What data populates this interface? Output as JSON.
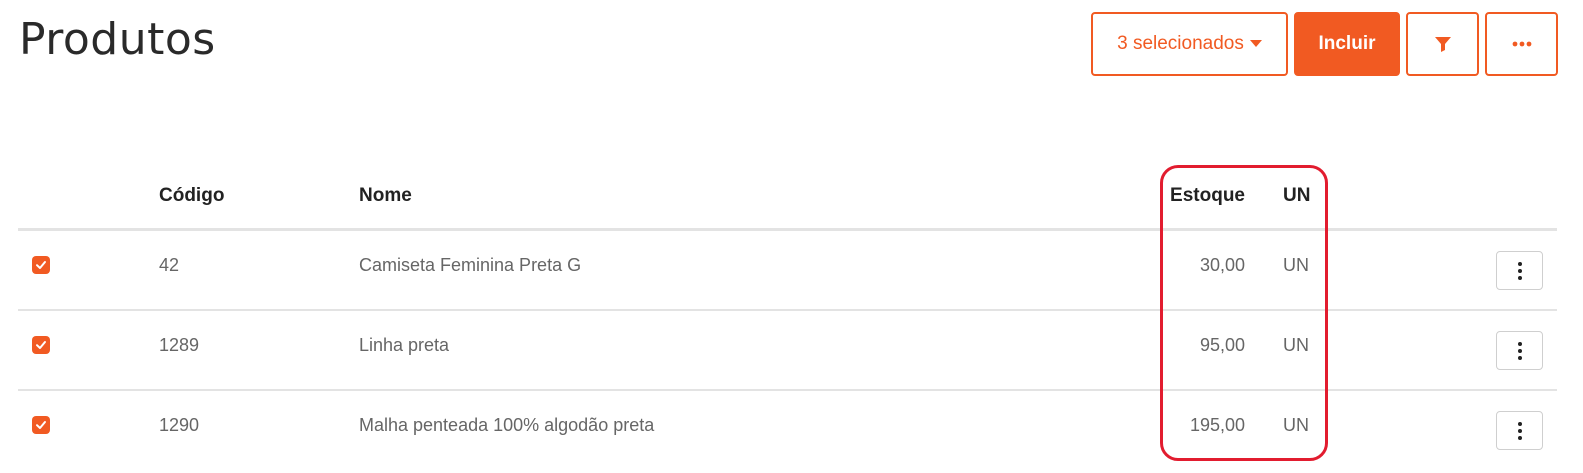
{
  "page": {
    "title": "Produtos"
  },
  "toolbar": {
    "selection_label": "3 selecionados",
    "include_label": "Incluir",
    "filter_icon": "filter-icon",
    "more_icon": "ellipsis-icon"
  },
  "table": {
    "headers": {
      "code": "Código",
      "name": "Nome",
      "stock": "Estoque",
      "unit": "UN"
    },
    "rows": [
      {
        "checked": true,
        "code": "42",
        "name": "Camiseta Feminina Preta G",
        "stock": "30,00",
        "unit": "UN"
      },
      {
        "checked": true,
        "code": "1289",
        "name": "Linha preta",
        "stock": "95,00",
        "unit": "UN"
      },
      {
        "checked": true,
        "code": "1290",
        "name": "Malha penteada 100% algodão preta",
        "stock": "195,00",
        "unit": "UN"
      }
    ]
  },
  "colors": {
    "accent": "#f15a22",
    "highlight": "#e21c2f"
  }
}
